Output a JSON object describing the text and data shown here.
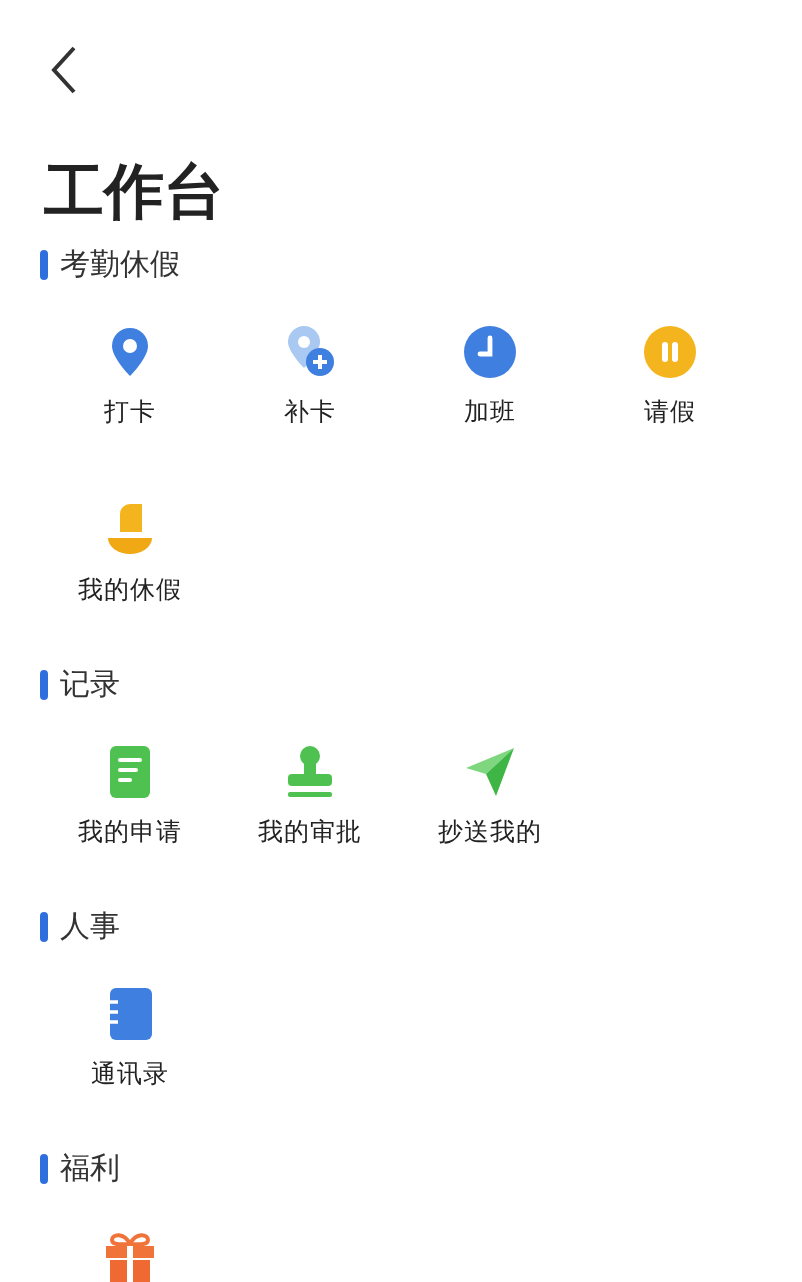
{
  "title": "工作台",
  "sections": [
    {
      "title": "考勤休假",
      "items": [
        {
          "label": "打卡",
          "kind": "pin"
        },
        {
          "label": "补卡",
          "kind": "pinplus"
        },
        {
          "label": "加班",
          "kind": "clock"
        },
        {
          "label": "请假",
          "kind": "pause"
        },
        {
          "label": "我的休假",
          "kind": "boat"
        }
      ]
    },
    {
      "title": "记录",
      "items": [
        {
          "label": "我的申请",
          "kind": "form"
        },
        {
          "label": "我的审批",
          "kind": "stamp"
        },
        {
          "label": "抄送我的",
          "kind": "send"
        }
      ]
    },
    {
      "title": "人事",
      "items": [
        {
          "label": "通讯录",
          "kind": "book"
        }
      ]
    },
    {
      "title": "福利",
      "items": [
        {
          "kind": "gift"
        }
      ]
    }
  ]
}
